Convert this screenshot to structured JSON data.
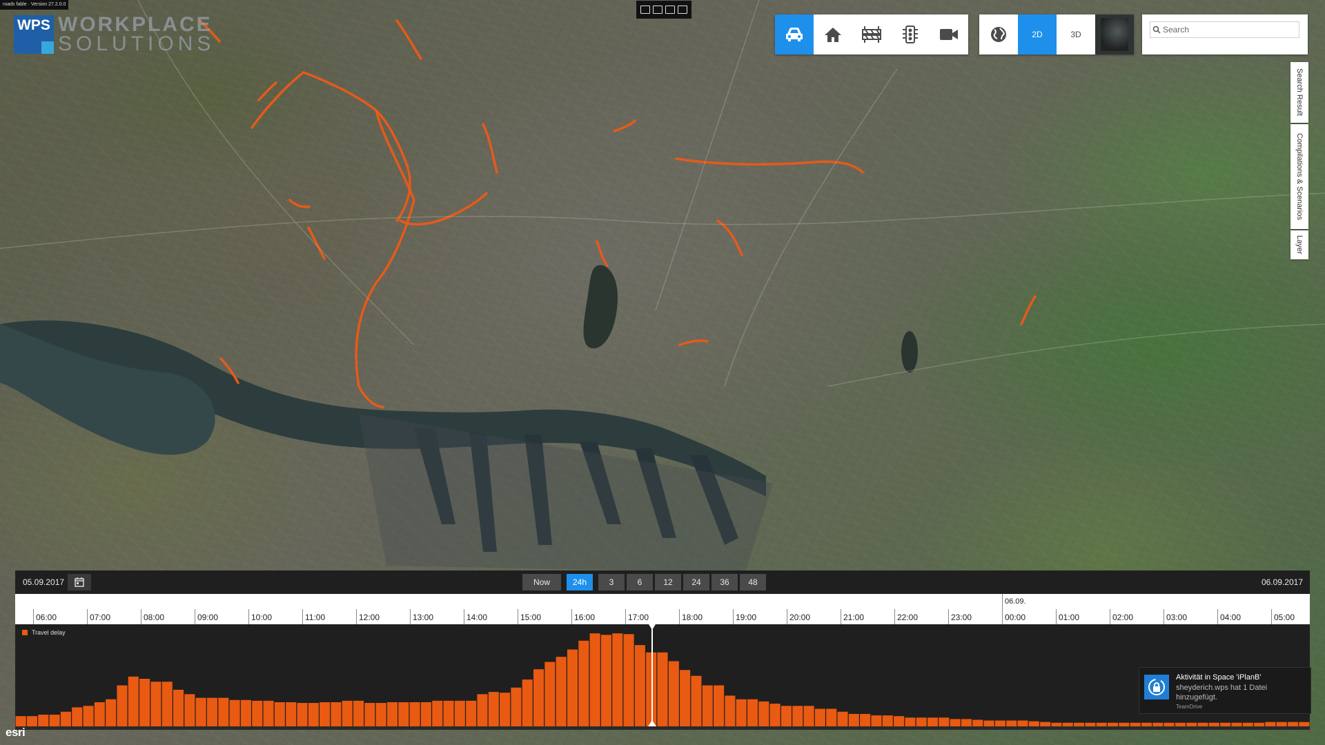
{
  "app": {
    "version_text": "roads fable · Version 27.2.0.0",
    "logo": {
      "abbr": "WPS",
      "line1": "WORKPLACE",
      "line2": "SOLUTIONS"
    },
    "attribution": "esri"
  },
  "mode_toolbar": {
    "items": [
      {
        "icon": "car-icon",
        "active": true
      },
      {
        "icon": "home-icon",
        "active": false
      },
      {
        "icon": "roadblock-icon",
        "active": false
      },
      {
        "icon": "traffic-light-icon",
        "active": false
      },
      {
        "icon": "video-camera-icon",
        "active": false
      }
    ]
  },
  "view_toolbar": {
    "globe_icon": "globe-icon",
    "btn_2d": "2D",
    "btn_3d": "3D",
    "active": "2D",
    "basemap_icon": "basemap-thumbnail"
  },
  "search": {
    "placeholder": "Search",
    "value": ""
  },
  "side_tabs": [
    "Search Result",
    "Compilations & Scenarios",
    "Layer"
  ],
  "timeline": {
    "start_date": "05.09.2017",
    "end_date": "06.09.2017",
    "now_label": "Now",
    "range_buttons": [
      "24h",
      "3",
      "6",
      "12",
      "24",
      "36",
      "48"
    ],
    "active_range": "24h",
    "hour_labels": [
      "06:00",
      "07:00",
      "08:00",
      "09:00",
      "10:00",
      "11:00",
      "12:00",
      "13:00",
      "14:00",
      "15:00",
      "16:00",
      "17:00",
      "18:00",
      "19:00",
      "20:00",
      "21:00",
      "22:00",
      "23:00",
      "00:00",
      "01:00",
      "02:00",
      "03:00",
      "04:00",
      "05:00"
    ],
    "day_label": "06.09.",
    "legend_label": "Travel delay",
    "series_color": "#e95a12",
    "cursor_time": "17:30"
  },
  "chart_data": {
    "type": "bar",
    "series": [
      {
        "name": "Travel delay",
        "values": [
          14,
          14,
          16,
          16,
          20,
          26,
          28,
          33,
          37,
          56,
          68,
          65,
          61,
          61,
          50,
          44,
          39,
          39,
          39,
          36,
          36,
          35,
          35,
          33,
          33,
          32,
          32,
          33,
          33,
          35,
          35,
          32,
          32,
          33,
          33,
          33,
          33,
          35,
          35,
          35,
          35,
          44,
          47,
          46,
          53,
          64,
          78,
          88,
          95,
          105,
          117,
          127,
          125,
          127,
          126,
          111,
          101,
          101,
          89,
          77,
          69,
          56,
          56,
          42,
          37,
          37,
          34,
          31,
          28,
          28,
          28,
          24,
          24,
          20,
          17,
          17,
          15,
          15,
          14,
          12,
          12,
          12,
          12,
          10,
          10,
          9,
          8,
          8,
          8,
          8,
          7,
          6,
          5,
          5,
          5,
          5,
          5,
          5,
          5,
          5,
          5,
          5,
          5,
          5,
          5,
          5,
          5,
          5,
          5,
          5,
          5,
          6,
          6,
          6,
          6
        ]
      }
    ],
    "ylim": [
      0,
      130
    ],
    "legend": "top-left"
  },
  "notification": {
    "title": "Aktivität in Space 'iPlanB'",
    "body": "sheyderich.wps hat 1 Datei hinzugefügt.",
    "source": "TeamDrive",
    "icon": "lock-sync-icon"
  }
}
